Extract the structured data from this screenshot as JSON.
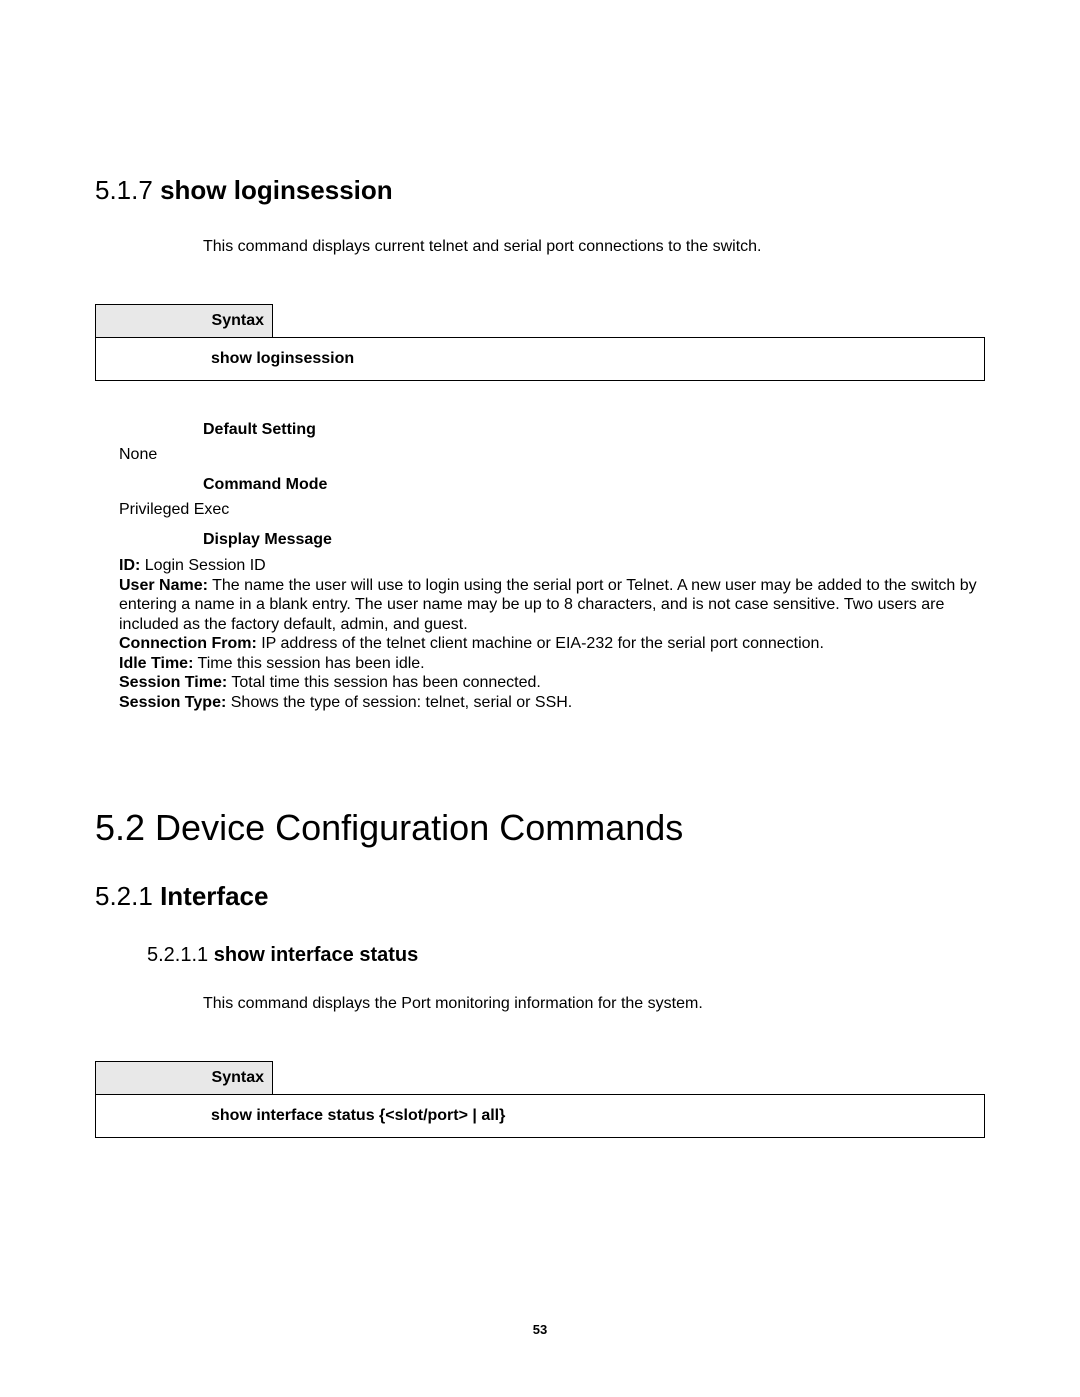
{
  "section_517": {
    "number": "5.1.7",
    "title": "show loginsession",
    "description": "This command displays current telnet and serial port connections to the switch.",
    "syntax_label": "Syntax",
    "syntax_content": "show loginsession",
    "default_setting_label": "Default Setting",
    "default_setting_value": "None",
    "command_mode_label": "Command Mode",
    "command_mode_value": "Privileged Exec",
    "display_message_label": "Display Message",
    "dm": {
      "id_label": "ID:",
      "id_text": " Login Session ID",
      "user_name_label": "User Name:",
      "user_name_text": " The name the user will use to login using the serial port or Telnet. A new user may be added to the switch by entering a name in a blank entry. The user name may be up to 8 characters, and is not case sensitive. Two users are included as the factory default, admin, and guest.",
      "connection_from_label": "Connection From:",
      "connection_from_text": " IP address of the telnet client machine or EIA-232 for the serial port connection.",
      "idle_time_label": "Idle Time:",
      "idle_time_text": " Time this session has been idle.",
      "session_time_label": "Session Time:",
      "session_time_text": " Total time this session has been connected.",
      "session_type_label": "Session Type:",
      "session_type_text": " Shows the type of session: telnet, serial or SSH."
    }
  },
  "section_52": {
    "heading": "5.2 Device Configuration Commands"
  },
  "section_521": {
    "number": "5.2.1",
    "title": "Interface"
  },
  "section_5211": {
    "number": "5.2.1.1",
    "title": "show interface status",
    "description": "This command displays the Port monitoring information for the system.",
    "syntax_label": "Syntax",
    "syntax_content": "show interface status {<slot/port> | all}"
  },
  "page_number": "53"
}
